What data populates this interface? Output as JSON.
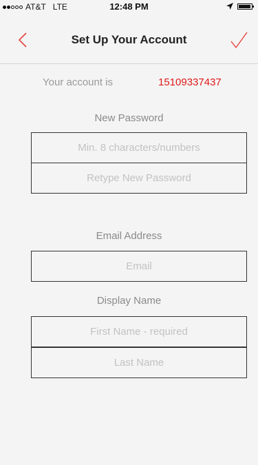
{
  "status_bar": {
    "carrier": "AT&T",
    "network": "LTE",
    "time": "12:48 PM",
    "signal_bars_filled": 2,
    "signal_bars_total": 5
  },
  "nav": {
    "title": "Set Up Your Account",
    "back_icon": "chevron-left-icon",
    "done_icon": "checkmark-icon",
    "accent_color": "#e8423c"
  },
  "account": {
    "label": "Your account is",
    "number": "15109337437",
    "number_color": "#e01818"
  },
  "password_section": {
    "label": "New Password",
    "password_placeholder": "Min. 8 characters/numbers",
    "password_value": "",
    "retype_placeholder": "Retype New Password",
    "retype_value": ""
  },
  "email_section": {
    "label": "Email Address",
    "email_placeholder": "Email",
    "email_value": ""
  },
  "display_name_section": {
    "label": "Display Name",
    "first_name_placeholder": "First Name - required",
    "first_name_value": "",
    "last_name_placeholder": "Last Name",
    "last_name_value": ""
  }
}
